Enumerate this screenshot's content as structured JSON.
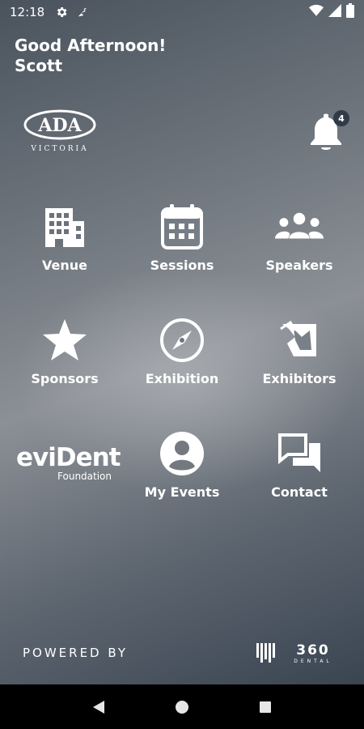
{
  "status_bar": {
    "time": "12:18",
    "icons": [
      "gear-icon",
      "signal-activity-icon",
      "wifi-icon",
      "cell-signal-icon",
      "battery-icon"
    ]
  },
  "greeting": {
    "line1": "Good Afternoon!",
    "line2": "Scott"
  },
  "header": {
    "logo_text": "ADA",
    "logo_subtext": "VICTORIA",
    "notification_count": "4"
  },
  "grid": {
    "venue": "Venue",
    "sessions": "Sessions",
    "speakers": "Speakers",
    "sponsors": "Sponsors",
    "exhibition": "Exhibition",
    "exhibitors": "Exhibitors",
    "my_events": "My Events",
    "contact": "Contact"
  },
  "evident": {
    "name": "eviDent",
    "subtitle": "Foundation"
  },
  "footer": {
    "powered_by": "POWERED BY",
    "brand": "360",
    "brand_sub": "DENTAL"
  },
  "colors": {
    "text": "#ffffff",
    "badge_bg": "#2f3b48",
    "nav_bg": "#000000"
  }
}
